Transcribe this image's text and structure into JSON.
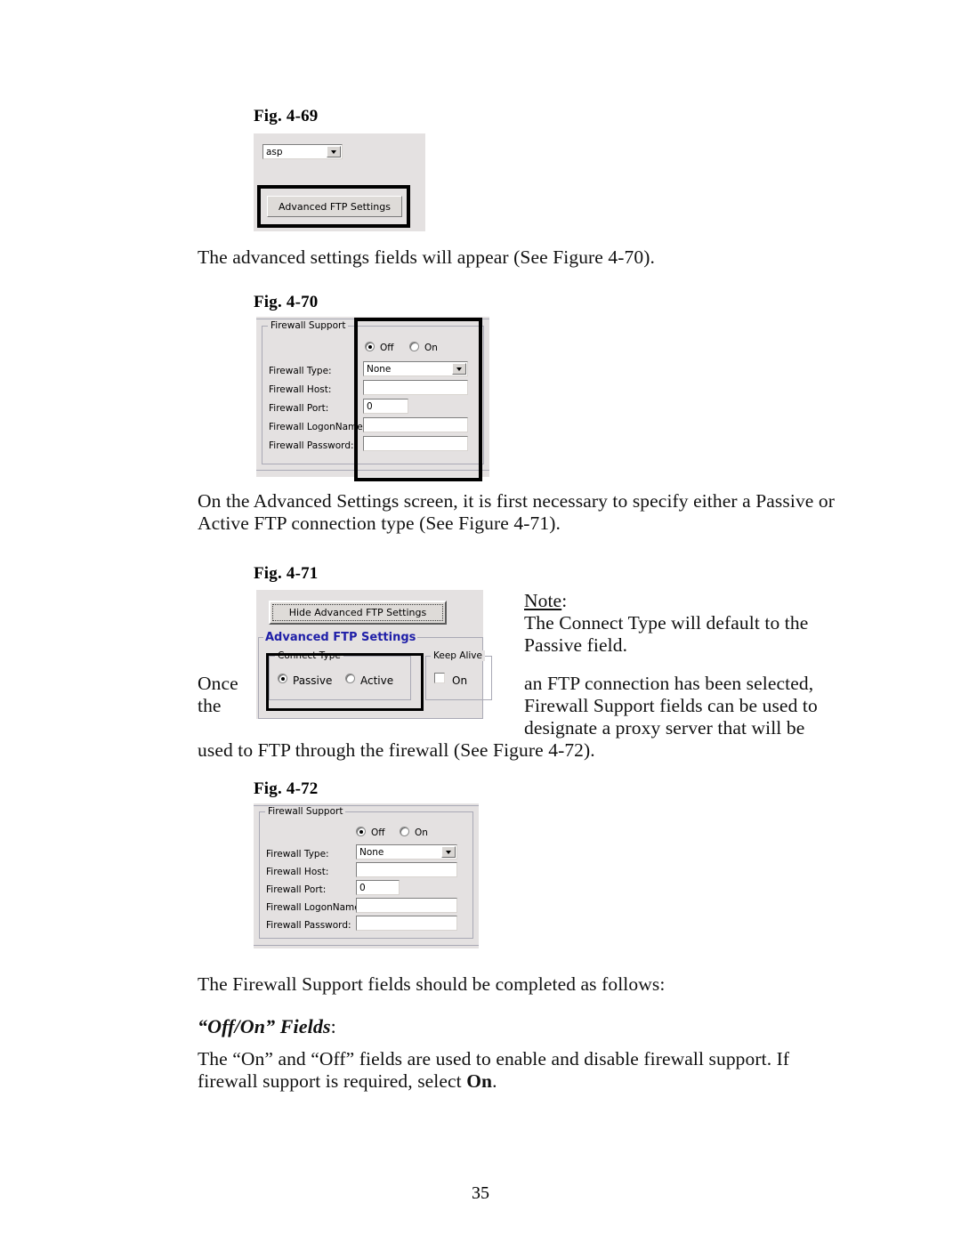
{
  "document": {
    "page_number": "35"
  },
  "figures": {
    "fig469": {
      "label": "Fig. 4-69",
      "combo_value": "asp",
      "button_label": "Advanced FTP Settings"
    },
    "fig470": {
      "label": "Fig.  4-70",
      "group_title": "Firewall Support",
      "radio_off": "Off",
      "radio_on": "On",
      "rows": [
        {
          "label": "Firewall Type:",
          "value": "None",
          "kind": "combo"
        },
        {
          "label": "Firewall Host:",
          "value": "",
          "kind": "text"
        },
        {
          "label": "Firewall Port:",
          "value": "0",
          "kind": "text-short"
        },
        {
          "label": "Firewall LogonName:",
          "value": "",
          "kind": "text"
        },
        {
          "label": "Firewall Password:",
          "value": "",
          "kind": "text"
        }
      ]
    },
    "fig471": {
      "label": "Fig.  4-71",
      "hide_button_label": "Hide Advanced FTP Settings",
      "section_title": "Advanced FTP Settings",
      "connect_type_title": "Connect Type",
      "connect_passive": "Passive",
      "connect_active": "Active",
      "keep_alive_title": "Keep Alive",
      "keep_alive_on": "On"
    },
    "fig472": {
      "label": "Fig.  4-72",
      "group_title": "Firewall Support",
      "radio_off": "Off",
      "radio_on": "On",
      "rows": [
        {
          "label": "Firewall Type:",
          "value": "None",
          "kind": "combo"
        },
        {
          "label": "Firewall Host:",
          "value": "",
          "kind": "text"
        },
        {
          "label": "Firewall Port:",
          "value": "0",
          "kind": "text-short"
        },
        {
          "label": "Firewall LogonName:",
          "value": "",
          "kind": "text"
        },
        {
          "label": "Firewall Password:",
          "value": "",
          "kind": "text"
        }
      ]
    }
  },
  "paragraphs": {
    "p1": "The advanced settings fields will appear (See Figure 4-70).",
    "p2_line1": "On the Advanced Settings screen, it is first necessary to specify either a Passive or",
    "p2_line2": "Active FTP connection type (See Figure 4-71).",
    "note_heading": "Note",
    "note_colon": ":",
    "note_line1": "The Connect Type will default to the",
    "note_line2": "Passive field.",
    "wrap_left_line1": "Once",
    "wrap_left_line2": "the",
    "wrap_right_line1": "an FTP connection has been selected,",
    "wrap_right_line2": "Firewall Support fields can be used to",
    "wrap_right_line3": "designate a proxy server that will be",
    "wrap_full_line": "used to FTP through the firewall (See Figure 4-72).",
    "p4": "The Firewall Support fields should be completed as follows:",
    "heading_offon": "“Off/On” Fields",
    "heading_offon_colon": ":",
    "p5_line1a": "The “On” and “Off” fields are used to enable and disable firewall support.  If",
    "p5_line2a": "firewall support is required, select ",
    "p5_line2b": "On",
    "p5_line2c": "."
  },
  "colors": {
    "dialog_background": "#e4e1e1",
    "accent_blue": "#1f1fa8",
    "highlight_border": "#000000",
    "field_background": "#ffffff"
  }
}
